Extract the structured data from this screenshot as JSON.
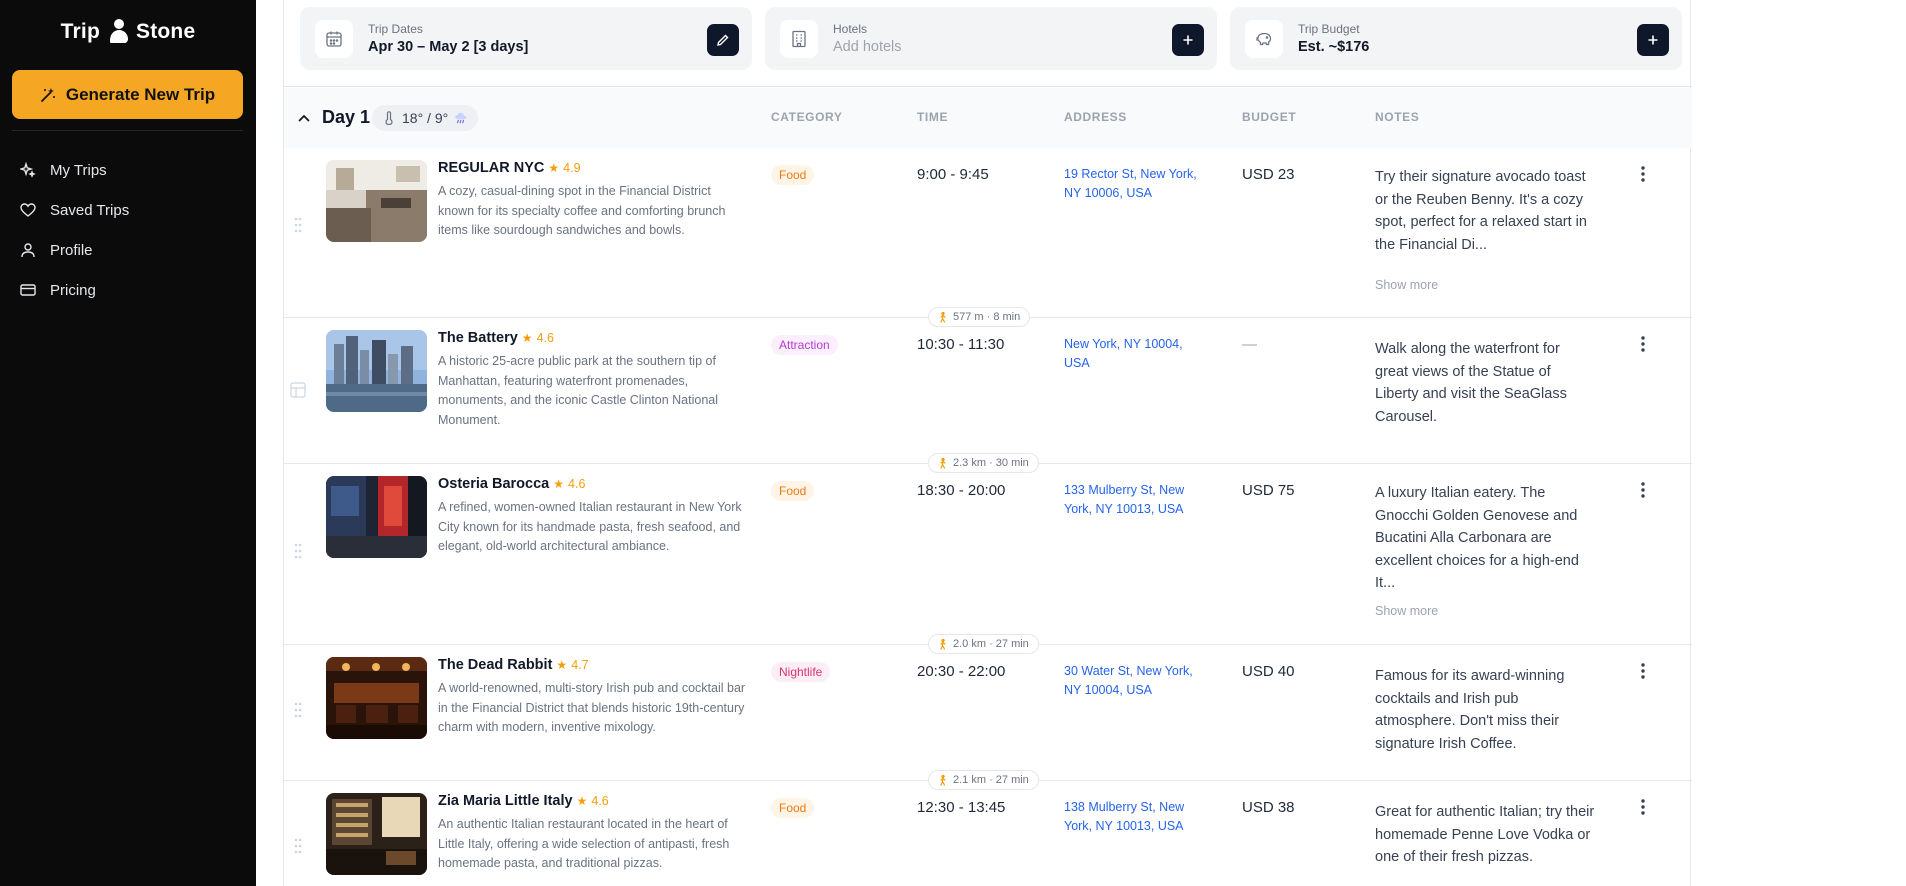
{
  "sidebar": {
    "logo_left": "Trip",
    "logo_right": "Stone",
    "generate_label": "Generate New Trip",
    "nav": [
      {
        "label": "My Trips",
        "icon": "sparkle-icon"
      },
      {
        "label": "Saved Trips",
        "icon": "heart-icon"
      },
      {
        "label": "Profile",
        "icon": "user-icon"
      },
      {
        "label": "Pricing",
        "icon": "credit-card-icon"
      }
    ]
  },
  "topbar": {
    "dates": {
      "label": "Trip Dates",
      "value": "Apr 30 – May 2 [3 days]",
      "icon": "calendar-icon",
      "action_icon": "pencil-icon"
    },
    "hotels": {
      "label": "Hotels",
      "placeholder": "Add hotels",
      "icon": "building-icon",
      "action_icon": "plus-icon"
    },
    "budget": {
      "label": "Trip Budget",
      "value": "Est. ~$176",
      "icon": "piggy-bank-icon",
      "action_icon": "plus-icon"
    }
  },
  "day": {
    "title": "Day 1",
    "weather": "18° / 9°",
    "columns": {
      "category": "CATEGORY",
      "time": "TIME",
      "address": "ADDRESS",
      "budget": "BUDGET",
      "notes": "NOTES"
    }
  },
  "items": [
    {
      "name": "REGULAR NYC",
      "star": "★",
      "rating": "4.9",
      "desc": "A cozy, casual-dining spot in the Financial District known for its specialty coffee and comforting brunch items like sourdough sandwiches and bowls.",
      "category": "Food",
      "time": "9:00 - 9:45",
      "address": "19 Rector St, New York, NY 10006, USA",
      "budget": "USD 23",
      "notes": "Try their signature avocado toast or the Reuben Benny. It's a cozy spot, perfect for a relaxed start in the Financial Di...",
      "more": "Show more"
    },
    {
      "name": "The Battery",
      "star": "★",
      "rating": "4.6",
      "desc": "A historic 25-acre public park at the southern tip of Manhattan, featuring waterfront promenades, monuments, and the iconic Castle Clinton National Monument.",
      "category": "Attraction",
      "time": "10:30 - 11:30",
      "address": "New York, NY 10004, USA",
      "budget": "—",
      "notes": "Walk along the waterfront for great views of the Statue of Liberty and visit the SeaGlass Carousel."
    },
    {
      "name": "Osteria Barocca",
      "star": "★",
      "rating": "4.6",
      "desc": "A refined, women-owned Italian restaurant in New York City known for its handmade pasta, fresh seafood, and elegant, old-world architectural ambiance.",
      "category": "Food",
      "time": "18:30 - 20:00",
      "address": "133 Mulberry St, New York, NY 10013, USA",
      "budget": "USD 75",
      "notes": "A luxury Italian eatery. The Gnocchi Golden Genovese and Bucatini Alla Carbonara are excellent choices for a high-end It...",
      "more": "Show more"
    },
    {
      "name": "The Dead Rabbit",
      "star": "★",
      "rating": "4.7",
      "desc": "A world-renowned, multi-story Irish pub and cocktail bar in the Financial District that blends historic 19th-century charm with modern, inventive mixology.",
      "category": "Nightlife",
      "time": "20:30 - 22:00",
      "address": "30 Water St, New York, NY 10004, USA",
      "budget": "USD 40",
      "notes": "Famous for its award-winning cocktails and Irish pub atmosphere. Don't miss their signature Irish Coffee."
    },
    {
      "name": "Zia Maria Little Italy",
      "star": "★",
      "rating": "4.6",
      "desc": "An authentic Italian restaurant located in the heart of Little Italy, offering a wide selection of antipasti, fresh homemade pasta, and traditional pizzas.",
      "category": "Food",
      "time": "12:30 - 13:45",
      "address": "138 Mulberry St, New York, NY 10013, USA",
      "budget": "USD 38",
      "notes": "Great for authentic Italian; try their homemade Penne Love Vodka or one of their fresh pizzas."
    }
  ],
  "travel": [
    {
      "text": "577 m · 8 min",
      "icon": "walking-icon"
    },
    {
      "text": "2.3 km · 30 min",
      "icon": "walking-icon"
    },
    {
      "text": "2.0 km · 27 min",
      "icon": "walking-icon"
    },
    {
      "text": "2.1 km · 27 min",
      "icon": "walking-icon"
    }
  ],
  "colors": {
    "accent": "#f5a623",
    "sidebar": "#0b0b0b",
    "link": "#2563eb",
    "rating": "#f59e0b"
  }
}
